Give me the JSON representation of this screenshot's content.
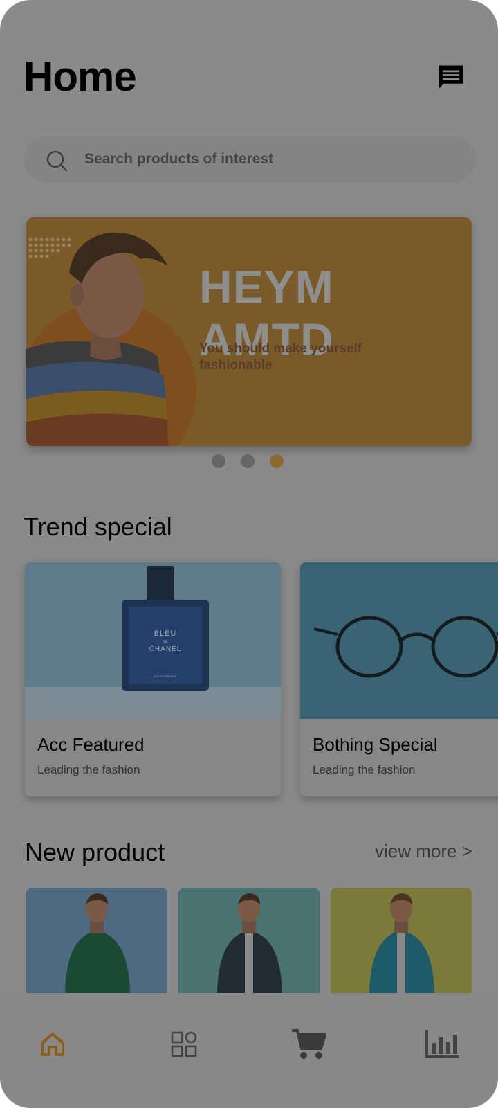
{
  "header": {
    "title": "Home"
  },
  "search": {
    "placeholder": "Search products of interest"
  },
  "banner": {
    "title": "HEYM AMTD",
    "subtitle": "You should make yourself fashionable",
    "slide_count": 3,
    "active_slide": 3
  },
  "trend": {
    "title": "Trend special",
    "cards": [
      {
        "name": "Acc Featured",
        "desc": "Leading the fashion",
        "bottle_text": [
          "BLEU",
          "DE",
          "CHANEL",
          "EAU DE PARFUM"
        ]
      },
      {
        "name": "Bothing Special",
        "desc": "Leading the fashion"
      }
    ]
  },
  "new_products": {
    "title": "New product",
    "view_more": "view more >"
  },
  "nav": {
    "items": [
      {
        "icon": "home-icon",
        "active": true
      },
      {
        "icon": "categories-icon",
        "active": false
      },
      {
        "icon": "cart-icon",
        "active": false
      },
      {
        "icon": "stats-icon",
        "active": false
      }
    ]
  },
  "colors": {
    "accent": "#8a6a30",
    "background": "#8a8a8a"
  }
}
